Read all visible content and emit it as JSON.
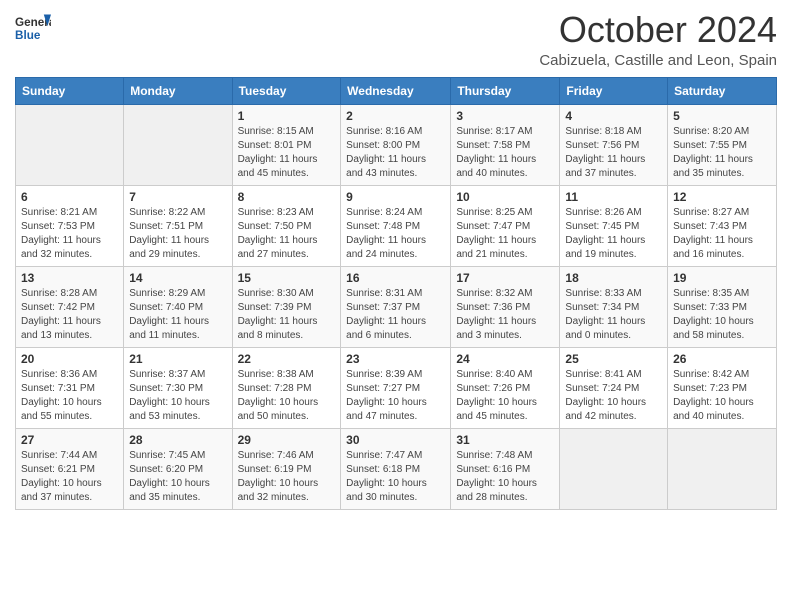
{
  "header": {
    "month_title": "October 2024",
    "location": "Cabizuela, Castille and Leon, Spain"
  },
  "days": [
    "Sunday",
    "Monday",
    "Tuesday",
    "Wednesday",
    "Thursday",
    "Friday",
    "Saturday"
  ],
  "weeks": [
    [
      {
        "day": "",
        "info": ""
      },
      {
        "day": "",
        "info": ""
      },
      {
        "day": "1",
        "info": "Sunrise: 8:15 AM\nSunset: 8:01 PM\nDaylight: 11 hours and 45 minutes."
      },
      {
        "day": "2",
        "info": "Sunrise: 8:16 AM\nSunset: 8:00 PM\nDaylight: 11 hours and 43 minutes."
      },
      {
        "day": "3",
        "info": "Sunrise: 8:17 AM\nSunset: 7:58 PM\nDaylight: 11 hours and 40 minutes."
      },
      {
        "day": "4",
        "info": "Sunrise: 8:18 AM\nSunset: 7:56 PM\nDaylight: 11 hours and 37 minutes."
      },
      {
        "day": "5",
        "info": "Sunrise: 8:20 AM\nSunset: 7:55 PM\nDaylight: 11 hours and 35 minutes."
      }
    ],
    [
      {
        "day": "6",
        "info": "Sunrise: 8:21 AM\nSunset: 7:53 PM\nDaylight: 11 hours and 32 minutes."
      },
      {
        "day": "7",
        "info": "Sunrise: 8:22 AM\nSunset: 7:51 PM\nDaylight: 11 hours and 29 minutes."
      },
      {
        "day": "8",
        "info": "Sunrise: 8:23 AM\nSunset: 7:50 PM\nDaylight: 11 hours and 27 minutes."
      },
      {
        "day": "9",
        "info": "Sunrise: 8:24 AM\nSunset: 7:48 PM\nDaylight: 11 hours and 24 minutes."
      },
      {
        "day": "10",
        "info": "Sunrise: 8:25 AM\nSunset: 7:47 PM\nDaylight: 11 hours and 21 minutes."
      },
      {
        "day": "11",
        "info": "Sunrise: 8:26 AM\nSunset: 7:45 PM\nDaylight: 11 hours and 19 minutes."
      },
      {
        "day": "12",
        "info": "Sunrise: 8:27 AM\nSunset: 7:43 PM\nDaylight: 11 hours and 16 minutes."
      }
    ],
    [
      {
        "day": "13",
        "info": "Sunrise: 8:28 AM\nSunset: 7:42 PM\nDaylight: 11 hours and 13 minutes."
      },
      {
        "day": "14",
        "info": "Sunrise: 8:29 AM\nSunset: 7:40 PM\nDaylight: 11 hours and 11 minutes."
      },
      {
        "day": "15",
        "info": "Sunrise: 8:30 AM\nSunset: 7:39 PM\nDaylight: 11 hours and 8 minutes."
      },
      {
        "day": "16",
        "info": "Sunrise: 8:31 AM\nSunset: 7:37 PM\nDaylight: 11 hours and 6 minutes."
      },
      {
        "day": "17",
        "info": "Sunrise: 8:32 AM\nSunset: 7:36 PM\nDaylight: 11 hours and 3 minutes."
      },
      {
        "day": "18",
        "info": "Sunrise: 8:33 AM\nSunset: 7:34 PM\nDaylight: 11 hours and 0 minutes."
      },
      {
        "day": "19",
        "info": "Sunrise: 8:35 AM\nSunset: 7:33 PM\nDaylight: 10 hours and 58 minutes."
      }
    ],
    [
      {
        "day": "20",
        "info": "Sunrise: 8:36 AM\nSunset: 7:31 PM\nDaylight: 10 hours and 55 minutes."
      },
      {
        "day": "21",
        "info": "Sunrise: 8:37 AM\nSunset: 7:30 PM\nDaylight: 10 hours and 53 minutes."
      },
      {
        "day": "22",
        "info": "Sunrise: 8:38 AM\nSunset: 7:28 PM\nDaylight: 10 hours and 50 minutes."
      },
      {
        "day": "23",
        "info": "Sunrise: 8:39 AM\nSunset: 7:27 PM\nDaylight: 10 hours and 47 minutes."
      },
      {
        "day": "24",
        "info": "Sunrise: 8:40 AM\nSunset: 7:26 PM\nDaylight: 10 hours and 45 minutes."
      },
      {
        "day": "25",
        "info": "Sunrise: 8:41 AM\nSunset: 7:24 PM\nDaylight: 10 hours and 42 minutes."
      },
      {
        "day": "26",
        "info": "Sunrise: 8:42 AM\nSunset: 7:23 PM\nDaylight: 10 hours and 40 minutes."
      }
    ],
    [
      {
        "day": "27",
        "info": "Sunrise: 7:44 AM\nSunset: 6:21 PM\nDaylight: 10 hours and 37 minutes."
      },
      {
        "day": "28",
        "info": "Sunrise: 7:45 AM\nSunset: 6:20 PM\nDaylight: 10 hours and 35 minutes."
      },
      {
        "day": "29",
        "info": "Sunrise: 7:46 AM\nSunset: 6:19 PM\nDaylight: 10 hours and 32 minutes."
      },
      {
        "day": "30",
        "info": "Sunrise: 7:47 AM\nSunset: 6:18 PM\nDaylight: 10 hours and 30 minutes."
      },
      {
        "day": "31",
        "info": "Sunrise: 7:48 AM\nSunset: 6:16 PM\nDaylight: 10 hours and 28 minutes."
      },
      {
        "day": "",
        "info": ""
      },
      {
        "day": "",
        "info": ""
      }
    ]
  ]
}
